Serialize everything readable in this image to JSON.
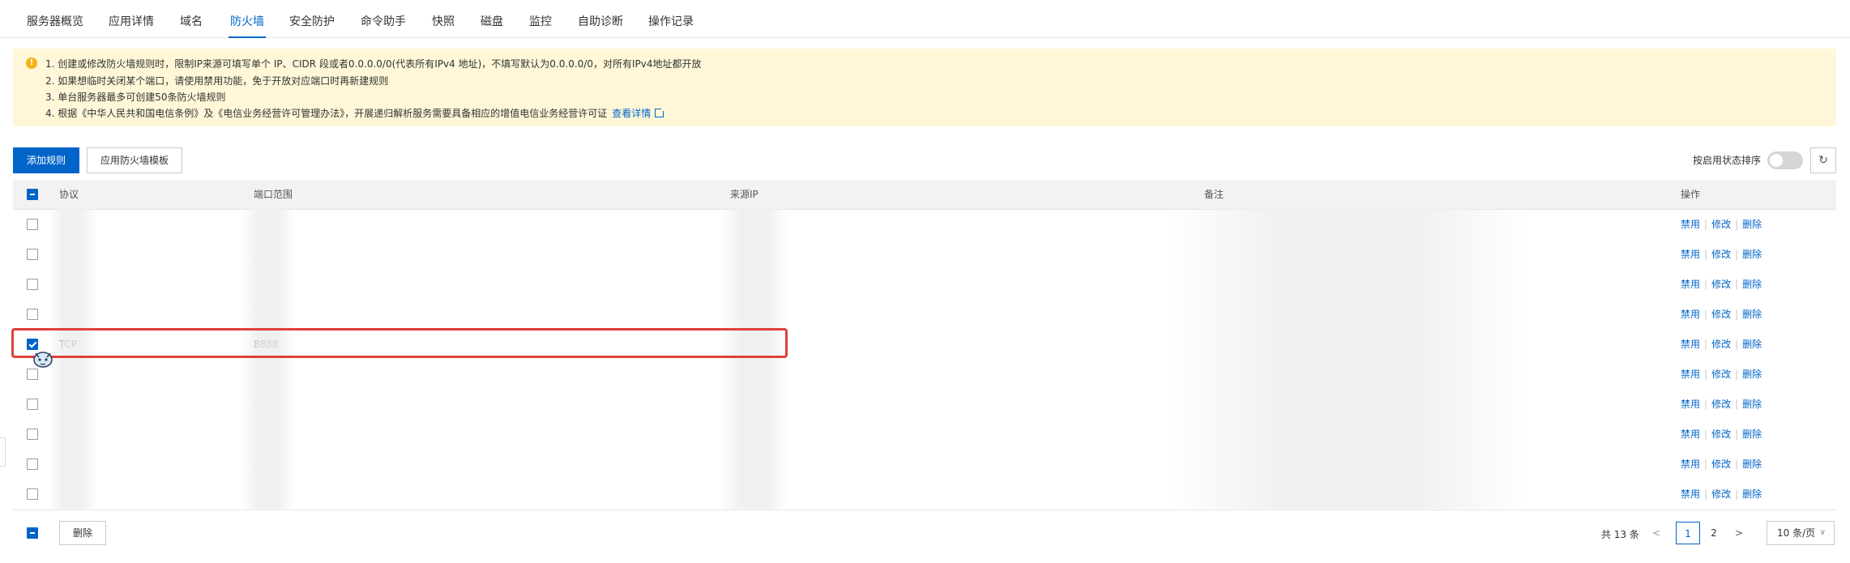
{
  "tabs": [
    {
      "label": "服务器概览"
    },
    {
      "label": "应用详情"
    },
    {
      "label": "域名"
    },
    {
      "label": "防火墙"
    },
    {
      "label": "安全防护"
    },
    {
      "label": "命令助手"
    },
    {
      "label": "快照"
    },
    {
      "label": "磁盘"
    },
    {
      "label": "监控"
    },
    {
      "label": "自助诊断"
    },
    {
      "label": "操作记录"
    }
  ],
  "active_tab": "防火墙",
  "notice": {
    "line1": "1. 创建或修改防火墙规则时，限制IP来源可填写单个 IP、CIDR 段或者0.0.0.0/0(代表所有IPv4 地址)，不填写默认为0.0.0.0/0，对所有IPv4地址都开放",
    "line2": "2. 如果想临时关闭某个端口，请使用禁用功能，免于开放对应端口时再新建规则",
    "line3": "3. 单台服务器最多可创建50条防火墙规则",
    "line4": "4. 根据《中华人民共和国电信条例》及《电信业务经营许可管理办法》，开展递归解析服务需要具备相应的增值电信业务经营许可证",
    "link": "查看详情"
  },
  "toolbar": {
    "add_rule": "添加规则",
    "apply_template": "应用防火墙模板",
    "sort_label": "按启用状态排序",
    "sort_enabled": false
  },
  "table": {
    "headers": {
      "protocol": "协议",
      "port_range": "端口范围",
      "source_ip": "来源IP",
      "remark": "备注",
      "actions": "操作"
    },
    "rows": [
      {
        "protocol": "",
        "port": "",
        "checked": false
      },
      {
        "protocol": "",
        "port": "",
        "checked": false
      },
      {
        "protocol": "",
        "port": "",
        "checked": false
      },
      {
        "protocol": "",
        "port": "",
        "checked": false
      },
      {
        "protocol": "TCP",
        "port": "8888",
        "checked": true
      },
      {
        "protocol": "",
        "port": "",
        "checked": false
      },
      {
        "protocol": "",
        "port": "",
        "checked": false
      },
      {
        "protocol": "",
        "port": "",
        "checked": false
      },
      {
        "protocol": "",
        "port": "",
        "checked": false
      },
      {
        "protocol": "",
        "port": "",
        "checked": false
      }
    ],
    "actions": {
      "disable": "禁用",
      "edit": "修改",
      "delete": "删除"
    }
  },
  "footer": {
    "delete": "删除",
    "total": "共 13 条",
    "pages": [
      "1",
      "2"
    ],
    "current_page": "1",
    "page_size": "10 条/页"
  },
  "colors": {
    "accent": "#0064c8",
    "notice_bg": "#fff7d8",
    "highlight": "#e0403a"
  }
}
